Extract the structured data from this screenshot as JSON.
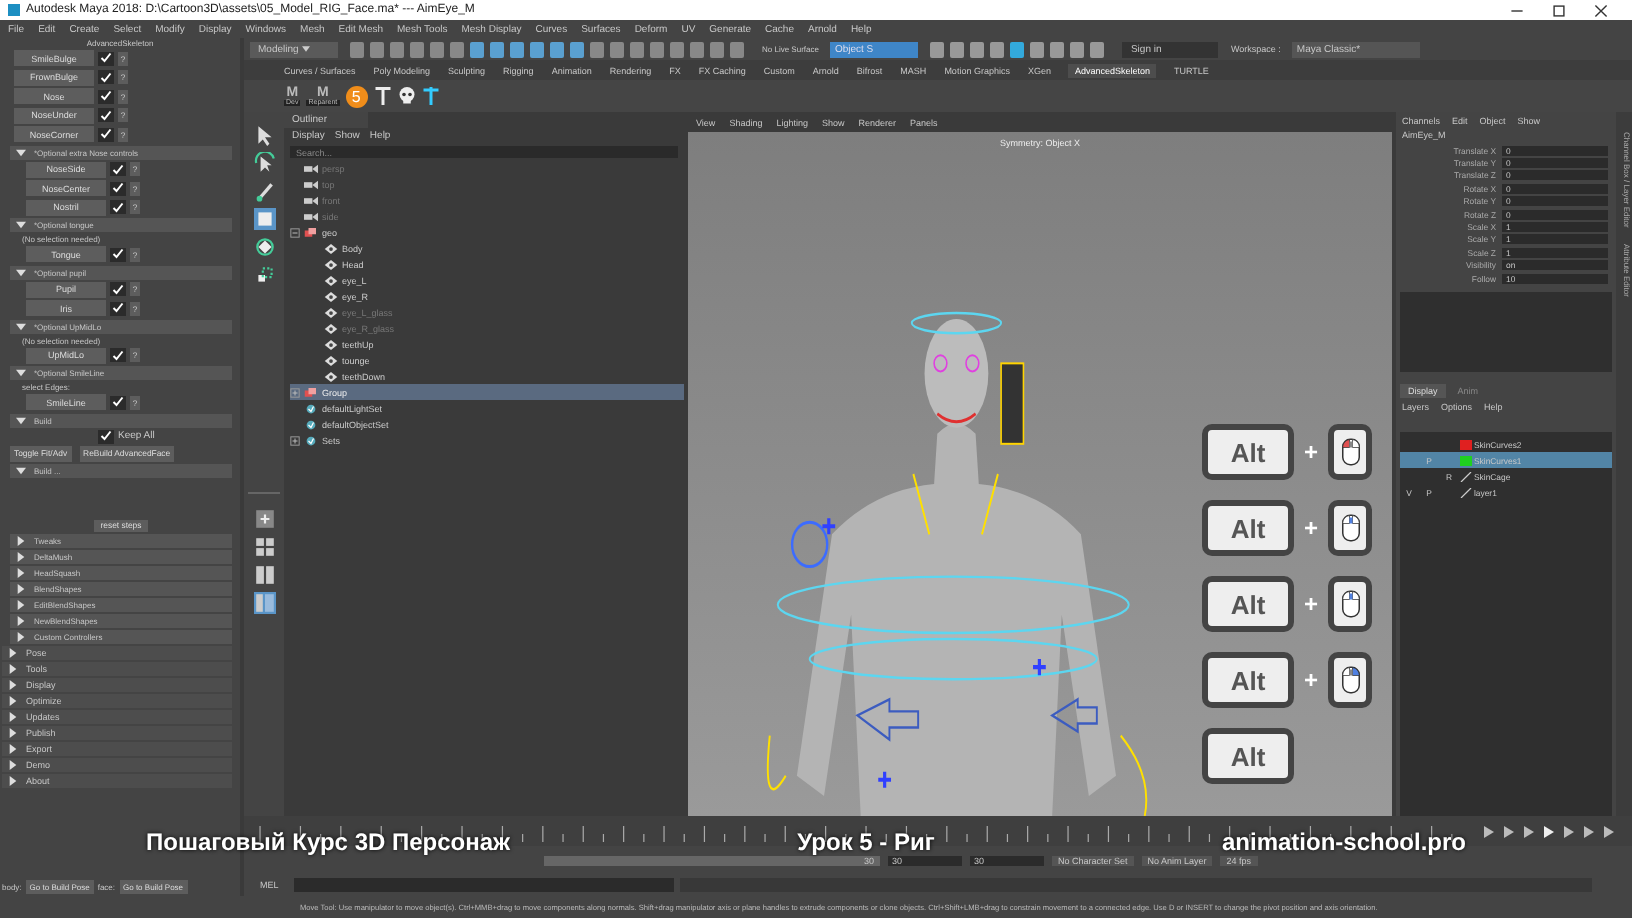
{
  "window": {
    "title": "Autodesk Maya 2018: D:\\Cartoon3D\\assets\\05_Model_RIG_Face.ma*  ---  AimEye_M"
  },
  "menu": [
    "File",
    "Edit",
    "Create",
    "Select",
    "Modify",
    "Display",
    "Windows",
    "Mesh",
    "Edit Mesh",
    "Mesh Tools",
    "Mesh Display",
    "Curves",
    "Surfaces",
    "Deform",
    "UV",
    "Generate",
    "Cache",
    "Arnold",
    "Help"
  ],
  "status_line": {
    "mode": "Modeling",
    "live_surface": "No Live Surface",
    "object_field": "Object S",
    "sign_in": "Sign in",
    "workspace_label": "Workspace :",
    "workspace": "Maya Classic*"
  },
  "shelf": {
    "tabs": [
      {
        "label": "Curves / Surfaces",
        "selected": false
      },
      {
        "label": "Poly Modeling",
        "selected": false
      },
      {
        "label": "Sculpting",
        "selected": false
      },
      {
        "label": "Rigging",
        "selected": false
      },
      {
        "label": "Animation",
        "selected": false
      },
      {
        "label": "Rendering",
        "selected": false
      },
      {
        "label": "FX",
        "selected": false
      },
      {
        "label": "FX Caching",
        "selected": false
      },
      {
        "label": "Custom",
        "selected": false
      },
      {
        "label": "Arnold",
        "selected": false
      },
      {
        "label": "Bifrost",
        "selected": false
      },
      {
        "label": "MASH",
        "selected": false
      },
      {
        "label": "Motion Graphics",
        "selected": false
      },
      {
        "label": "XGen",
        "selected": false
      },
      {
        "label": "AdvancedSkeleton",
        "selected": true
      },
      {
        "label": "TURTLE",
        "selected": false
      }
    ],
    "items": [
      {
        "kind": "m",
        "glyph": "M",
        "label": "Dev"
      },
      {
        "kind": "m",
        "glyph": "M",
        "label": "Reparent"
      },
      {
        "kind": "badge",
        "label": "5"
      },
      {
        "kind": "joint"
      },
      {
        "kind": "skull"
      },
      {
        "kind": "joint-blue"
      }
    ]
  },
  "left_panel": {
    "title": "AdvancedSkeleton",
    "items": [
      {
        "kind": "step",
        "label": "SmileBulge",
        "checked": true,
        "help": "?"
      },
      {
        "kind": "step",
        "label": "FrownBulge",
        "checked": true,
        "help": "?"
      },
      {
        "kind": "step",
        "label": "Nose",
        "checked": true,
        "help": "?"
      },
      {
        "kind": "step",
        "label": "NoseUnder",
        "checked": true,
        "help": "?"
      },
      {
        "kind": "step",
        "label": "NoseCorner",
        "checked": true,
        "help": "?"
      },
      {
        "kind": "header",
        "label": "*Optional extra Nose controls",
        "expanded": true,
        "children": [
          {
            "kind": "step",
            "label": "NoseSide",
            "checked": true,
            "help": "?"
          },
          {
            "kind": "step",
            "label": "NoseCenter",
            "checked": true,
            "help": "?"
          },
          {
            "kind": "step",
            "label": "Nostril",
            "checked": true,
            "help": "?"
          }
        ]
      },
      {
        "kind": "header",
        "label": "*Optional tongue",
        "expanded": true,
        "children": [
          {
            "kind": "note",
            "label": "(No selection needed)"
          },
          {
            "kind": "step",
            "label": "Tongue",
            "checked": true,
            "help": "?"
          }
        ]
      },
      {
        "kind": "header",
        "label": "*Optional pupil",
        "expanded": true,
        "children": [
          {
            "kind": "step",
            "label": "Pupil",
            "checked": true,
            "help": "?"
          },
          {
            "kind": "step",
            "label": "Iris",
            "checked": true,
            "help": "?"
          }
        ]
      },
      {
        "kind": "header",
        "label": "*Optional UpMidLo",
        "expanded": true,
        "children": [
          {
            "kind": "note",
            "label": "(No selection needed)"
          },
          {
            "kind": "step",
            "label": "UpMidLo",
            "checked": true,
            "help": "?"
          }
        ]
      },
      {
        "kind": "header",
        "label": "*Optional SmileLine",
        "expanded": true,
        "children": [
          {
            "kind": "note",
            "label": "select Edges:"
          },
          {
            "kind": "step",
            "label": "SmileLine",
            "checked": true,
            "help": "?"
          }
        ]
      },
      {
        "kind": "header",
        "label": "Build",
        "expanded": true,
        "children": [
          {
            "kind": "check",
            "label": "Keep All",
            "checked": true
          },
          {
            "kind": "buttons",
            "labels": [
              "Toggle Fit/Adv",
              "ReBuild AdvancedFace"
            ]
          },
          {
            "kind": "header",
            "label": "Build ...",
            "expanded": true,
            "children": [
              {
                "kind": "action",
                "label": "reset steps"
              },
              {
                "kind": "header",
                "label": "Tweaks",
                "expanded": false
              },
              {
                "kind": "header",
                "label": "DeltaMush",
                "expanded": false
              },
              {
                "kind": "header",
                "label": "HeadSquash",
                "expanded": false
              },
              {
                "kind": "header",
                "label": "BlendShapes",
                "expanded": false
              },
              {
                "kind": "header",
                "label": "EditBlendShapes",
                "expanded": false
              },
              {
                "kind": "header",
                "label": "NewBlendShapes",
                "expanded": false
              },
              {
                "kind": "header",
                "label": "Custom Controllers",
                "expanded": false
              }
            ]
          }
        ]
      },
      {
        "kind": "section",
        "label": "Pose",
        "expanded": false
      },
      {
        "kind": "section",
        "label": "Tools",
        "expanded": false
      },
      {
        "kind": "section",
        "label": "Display",
        "expanded": false
      },
      {
        "kind": "section",
        "label": "Optimize",
        "expanded": false
      },
      {
        "kind": "section",
        "label": "Updates",
        "expanded": false
      },
      {
        "kind": "section",
        "label": "Publish",
        "expanded": false
      },
      {
        "kind": "section",
        "label": "Export",
        "expanded": false
      },
      {
        "kind": "section",
        "label": "Demo",
        "expanded": false
      },
      {
        "kind": "section",
        "label": "About",
        "expanded": false
      }
    ],
    "footer": [
      {
        "label": "body:",
        "button": "Go to Build Pose"
      },
      {
        "label": "face:",
        "button": "Go to Build Pose"
      }
    ]
  },
  "outliner": {
    "title": "Outliner",
    "menu": [
      "Display",
      "Show",
      "Help"
    ],
    "search_placeholder": "Search...",
    "items": [
      {
        "label": "persp",
        "kind": "camera",
        "hidden": true,
        "selected": false
      },
      {
        "label": "top",
        "kind": "camera",
        "hidden": true,
        "selected": false
      },
      {
        "label": "front",
        "kind": "camera",
        "hidden": true,
        "selected": false
      },
      {
        "label": "side",
        "kind": "camera",
        "hidden": true,
        "selected": false
      },
      {
        "label": "geo",
        "kind": "group",
        "hidden": false,
        "selected": false,
        "expanded": true,
        "children": [
          {
            "label": "Body",
            "kind": "mesh",
            "hidden": false,
            "selected": false
          },
          {
            "label": "Head",
            "kind": "mesh",
            "hidden": false,
            "selected": false
          },
          {
            "label": "eye_L",
            "kind": "mesh",
            "hidden": false,
            "selected": false
          },
          {
            "label": "eye_R",
            "kind": "mesh",
            "hidden": false,
            "selected": false
          },
          {
            "label": "eye_L_glass",
            "kind": "mesh",
            "hidden": true,
            "selected": false
          },
          {
            "label": "eye_R_glass",
            "kind": "mesh",
            "hidden": true,
            "selected": false
          },
          {
            "label": "teethUp",
            "kind": "mesh",
            "hidden": false,
            "selected": false
          },
          {
            "label": "tounge",
            "kind": "mesh",
            "hidden": false,
            "selected": false
          },
          {
            "label": "teethDown",
            "kind": "mesh",
            "hidden": false,
            "selected": false
          }
        ]
      },
      {
        "label": "Group",
        "kind": "group",
        "hidden": false,
        "selected": true,
        "expanded": false
      },
      {
        "label": "defaultLightSet",
        "kind": "set",
        "hidden": false,
        "selected": false
      },
      {
        "label": "defaultObjectSet",
        "kind": "set",
        "hidden": false,
        "selected": false
      },
      {
        "label": "Sets",
        "kind": "set",
        "hidden": false,
        "selected": false,
        "expanded": false
      }
    ]
  },
  "viewport": {
    "menu": [
      "View",
      "Shading",
      "Lighting",
      "Show",
      "Renderer",
      "Panels"
    ],
    "symmetry": "Symmetry: Object X",
    "key_hints": [
      {
        "key": "Alt",
        "plus": "+",
        "mouse": {
          "left": true,
          "middle": false,
          "right": false
        }
      },
      {
        "key": "Alt",
        "plus": "+",
        "mouse": {
          "left": false,
          "middle": true,
          "right": false
        }
      },
      {
        "key": "Alt",
        "plus": "+",
        "mouse": {
          "left": false,
          "middle": true,
          "right": false
        }
      },
      {
        "key": "Alt",
        "plus": "+",
        "mouse": {
          "left": false,
          "middle": false,
          "right": true
        }
      },
      {
        "key": "Alt"
      }
    ]
  },
  "channel_box": {
    "menu": [
      "Channels",
      "Edit",
      "Object",
      "Show"
    ],
    "object": "AimEye_M",
    "side_tabs": [
      "Channel Box / Layer Editor",
      "Attribute Editor"
    ],
    "attributes": [
      {
        "name": "Translate X",
        "value": "0"
      },
      {
        "name": "Translate Y",
        "value": "0"
      },
      {
        "name": "Translate Z",
        "value": "0"
      },
      {
        "name": "Rotate X",
        "value": "0"
      },
      {
        "name": "Rotate Y",
        "value": "0"
      },
      {
        "name": "Rotate Z",
        "value": "0"
      },
      {
        "name": "Scale X",
        "value": "1"
      },
      {
        "name": "Scale Y",
        "value": "1"
      },
      {
        "name": "Scale Z",
        "value": "1"
      },
      {
        "name": "Visibility",
        "value": "on"
      },
      {
        "name": "Follow",
        "value": "10"
      }
    ]
  },
  "layers": {
    "tabs": [
      {
        "label": "Display",
        "selected": true
      },
      {
        "label": "Anim",
        "selected": false
      }
    ],
    "menu": [
      "Layers",
      "Options",
      "Help"
    ],
    "items": [
      {
        "name": "SkinCurves2",
        "color": "#e02020",
        "selected": false
      },
      {
        "name": "SkinCurves1",
        "color": "#20d020",
        "selected": true,
        "p": "P"
      },
      {
        "name": "SkinCage",
        "selected": false,
        "r": "R"
      },
      {
        "name": "layer1",
        "selected": false,
        "v": "V",
        "p": "P"
      }
    ]
  },
  "range": {
    "level": 1,
    "fields": [
      "30",
      "30",
      "30"
    ],
    "character_set": "No Character Set",
    "anim_layer": "No Anim Layer",
    "fps": "24 fps"
  },
  "command_line": {
    "label": "MEL"
  },
  "help_line": "Move Tool: Use manipulator to move object(s). Ctrl+MMB+drag to move components along normals. Shift+drag manipulator axis or plane handles to extrude components or clone objects. Ctrl+Shift+LMB+drag to constrain movement to a connected edge. Use D or INSERT to change the pivot position and axis orientation.",
  "captions": [
    "Пошаговый Курс 3D Персонаж",
    "Урок 5 - Риг",
    "animation-school.pro"
  ]
}
